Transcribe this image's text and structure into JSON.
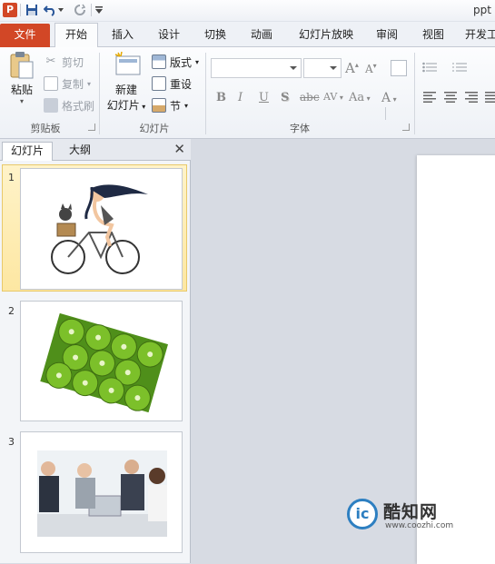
{
  "window": {
    "title": "ppt"
  },
  "tabs": [
    {
      "label": "文件"
    },
    {
      "label": "开始"
    },
    {
      "label": "插入"
    },
    {
      "label": "设计"
    },
    {
      "label": "切换"
    },
    {
      "label": "动画"
    },
    {
      "label": "幻灯片放映"
    },
    {
      "label": "审阅"
    },
    {
      "label": "视图"
    },
    {
      "label": "开发工"
    }
  ],
  "ribbon": {
    "clipboard": {
      "paste": "粘贴",
      "cut": "剪切",
      "copy": "复制",
      "format_painter": "格式刷",
      "group": "剪贴板"
    },
    "slides": {
      "new_slide_line1": "新建",
      "new_slide_line2": "幻灯片",
      "layout": "版式",
      "reset": "重设",
      "section": "节",
      "group": "幻灯片"
    },
    "font": {
      "group": "字体",
      "bold": "B",
      "italic": "I",
      "underline": "U",
      "shadow": "S",
      "strikethrough": "abc",
      "spacing": "AV",
      "case": "Aa",
      "color": "A",
      "grow": "A",
      "shrink": "A"
    }
  },
  "panel": {
    "tab_slides": "幻灯片",
    "tab_outline": "大纲",
    "slides": [
      {
        "number": "1",
        "image": "girl-on-bicycle-illustration"
      },
      {
        "number": "2",
        "image": "kiwi-slices-photo"
      },
      {
        "number": "3",
        "image": "business-meeting-photo"
      }
    ]
  },
  "watermark": {
    "name": "酷知网",
    "url": "www.coozhi.com",
    "logo_letter": "ic"
  },
  "colors": {
    "file_tab": "#d24726",
    "ribbon_bg": "#eef1f6",
    "selected_slide": "#fde7a2",
    "canvas": "#d7dbe3"
  }
}
